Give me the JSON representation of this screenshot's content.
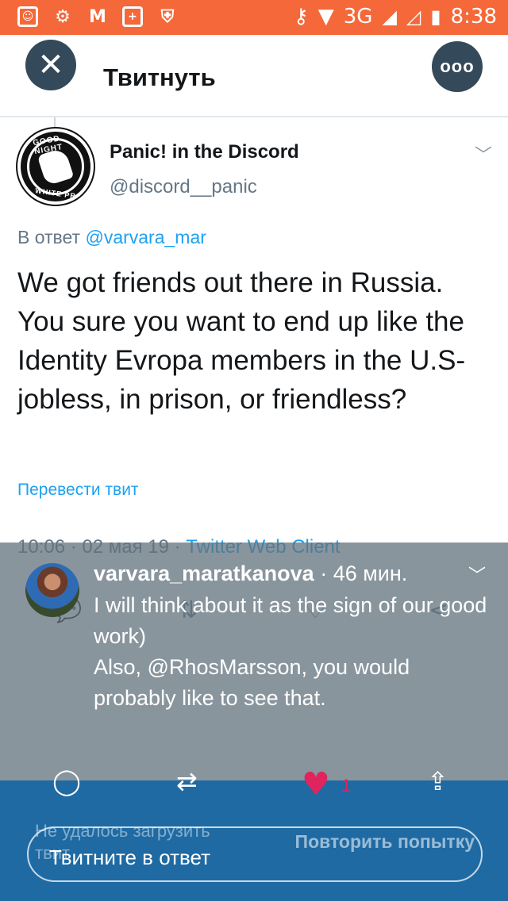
{
  "status_bar": {
    "network": "3G",
    "sim_r": "R",
    "sim_slot": "1",
    "time": "8:38",
    "background_color": "#f4683a"
  },
  "header": {
    "title": "Твитнуть",
    "close_icon": "close-icon",
    "more_icon": "more-icon"
  },
  "tweet": {
    "author_name": "Panic! in the Discord",
    "author_handle": "@discord__panic",
    "avatar_top_text": "GOOD NIGHT",
    "avatar_bottom_text": "WHITE PRIDE",
    "reply_prefix": "В ответ",
    "reply_mention": "@varvara_mar",
    "text": "We got friends out there in Russia. You sure you want to end up like the Identity Evropa members in the U.S- jobless, in prison, or friendless?",
    "translate_label": "Перевести твит",
    "timestamp": "10:06 · 02 мая 19 ·",
    "client": "Twitter Web Client"
  },
  "notification": {
    "user": "varvara_maratkanova",
    "time": "· 46 мин.",
    "text": "I will think about it as the sign of our good work)\nAlso, @RhosMarsson, you would probably like to see that."
  },
  "bottom": {
    "like_count": "1",
    "error_text": "Не удалось загрузить твит",
    "retry_label": "Повторить попытку",
    "reply_placeholder": "Твитните в ответ"
  },
  "colors": {
    "accent": "#1da1f2",
    "like": "#e0245e",
    "bottom_bar": "#1f6aa3"
  }
}
